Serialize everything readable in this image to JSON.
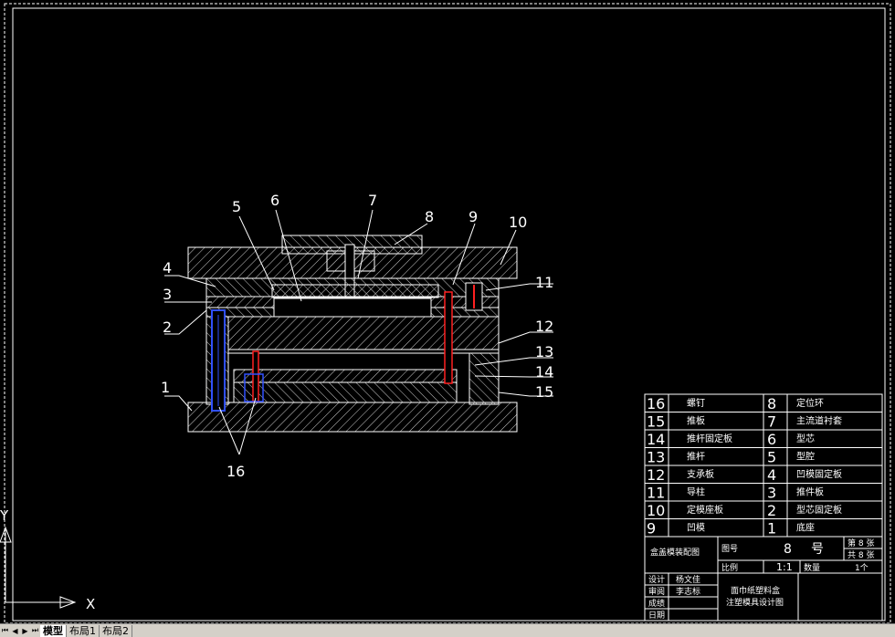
{
  "colors": {
    "background": "#000000",
    "line": "#ffffff",
    "hatch": "#cccccc",
    "pin_red": "#ff2020",
    "pin_blue": "#3050ff",
    "tab_bar": "#d4d0c8"
  },
  "drawing": {
    "balloons": [
      "1",
      "2",
      "3",
      "4",
      "5",
      "6",
      "7",
      "8",
      "9",
      "10",
      "11",
      "12",
      "13",
      "14",
      "15",
      "16"
    ]
  },
  "bom": {
    "rows": [
      {
        "no_l": "16",
        "name_l": "螺钉",
        "no_r": "8",
        "name_r": "定位环"
      },
      {
        "no_l": "15",
        "name_l": "推板",
        "no_r": "7",
        "name_r": "主流道衬套"
      },
      {
        "no_l": "14",
        "name_l": "推杆固定板",
        "no_r": "6",
        "name_r": "型芯"
      },
      {
        "no_l": "13",
        "name_l": "推杆",
        "no_r": "5",
        "name_r": "型腔"
      },
      {
        "no_l": "12",
        "name_l": "支承板",
        "no_r": "4",
        "name_r": "凹模固定板"
      },
      {
        "no_l": "11",
        "name_l": "导柱",
        "no_r": "3",
        "name_r": "推件板"
      },
      {
        "no_l": "10",
        "name_l": "定模座板",
        "no_r": "2",
        "name_r": "型芯固定板"
      },
      {
        "no_l": "9",
        "name_l": "凹模",
        "no_r": "1",
        "name_r": "底座"
      }
    ]
  },
  "title_block": {
    "drawing_name": "盒盖模装配图",
    "drawing_no_label": "图号",
    "drawing_no": "8",
    "drawing_no_unit": "号",
    "sheet_label": "第 8 张",
    "total_label": "共 8 张",
    "scale_label": "比例",
    "scale": "1:1",
    "qty_label": "数量",
    "qty": "1个",
    "design_label": "设计",
    "designer": "杨文佳",
    "review_label": "审阅",
    "reviewer": "李志标",
    "grade_label": "成绩",
    "date_label": "日期",
    "title_line1": "面巾纸塑料盒",
    "title_line2": "注塑模具设计图"
  },
  "ucs": {
    "y_label": "Y",
    "x_label": "X"
  },
  "tabs": {
    "model": "模型",
    "layout1": "布局1",
    "layout2": "布局2"
  }
}
